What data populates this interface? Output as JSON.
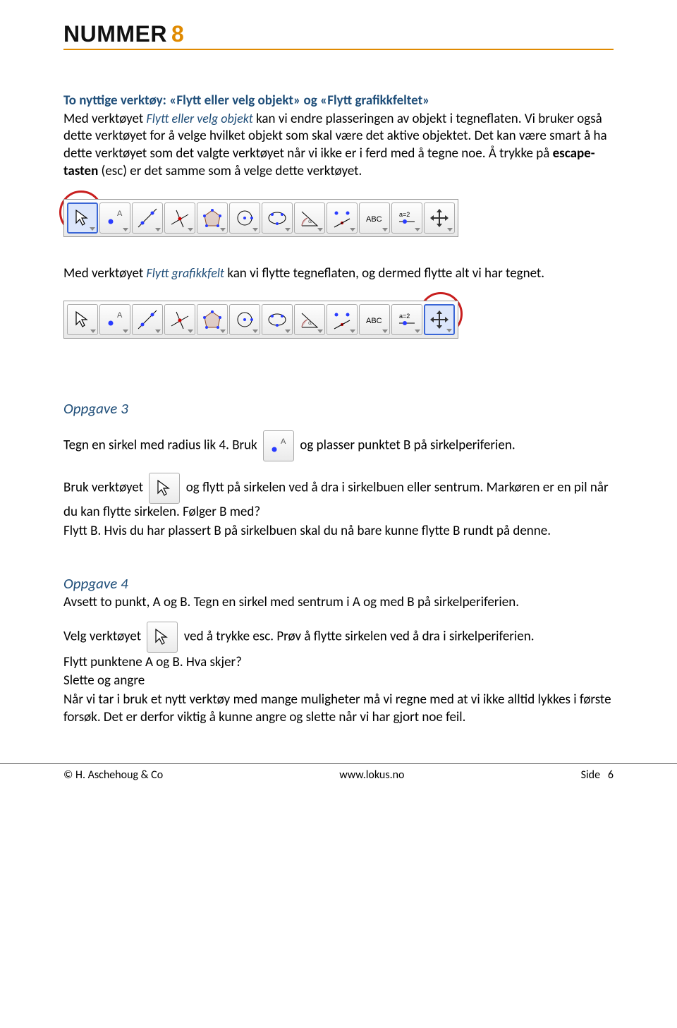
{
  "header": {
    "brand_word": "NUMMER",
    "brand_digit": "8"
  },
  "section1": {
    "title": "To nyttige verktøy: «Flytt eller velg objekt» og «Flytt grafikkfeltet»",
    "l1a": "Med verktøyet ",
    "l1_tool": "Flytt eller velg objekt",
    "l1b": " kan vi endre plasseringen av objekt i tegneflaten. Vi bruker også dette verktøyet for å velge hvilket objekt som skal være det aktive objektet. Det kan være smart å ha dette verktøyet som det valgte verktøyet når vi ikke er i ferd med å tegne noe. Å trykke på ",
    "l1_bold": "escape-tasten",
    "l1c": " (esc) er det samme som å velge dette verktøyet."
  },
  "section2": {
    "l1a": "Med verktøyet ",
    "l1_tool": "Flytt grafikkfelt",
    "l1b": " kan vi flytte tegneflaten, og dermed flytte alt vi har tegnet."
  },
  "opp3": {
    "title": "Oppgave 3",
    "p1a": "Tegn en sirkel med radius lik 4. Bruk ",
    "p1b": " og plasser punktet B på sirkelperiferien.",
    "p2a": "Bruk verktøyet ",
    "p2b": " og flytt på sirkelen ved å dra i sirkelbuen eller sentrum. Markøren er en pil når du kan flytte sirkelen. Følger B med?",
    "p3": "Flytt B. Hvis du har plassert B på sirkelbuen skal du nå bare kunne flytte B rundt på denne."
  },
  "opp4": {
    "title": "Oppgave 4",
    "p1": "Avsett to punkt, A og B. Tegn en sirkel med sentrum i A og med B på sirkelperiferien.",
    "p2a": "Velg verktøyet ",
    "p2b": " ved å trykke esc. Prøv å flytte sirkelen ved å dra i sirkelperiferien.",
    "p3": "Flytt punktene A og B. Hva skjer?",
    "p4": "Slette og angre",
    "p5": "Når vi tar i bruk et nytt verktøy med mange muligheter må vi regne med at vi ikke alltid lykkes i første forsøk. Det er derfor viktig å kunne angre og slette når vi har gjort noe feil."
  },
  "toolbar_labels": {
    "abc": "ABC",
    "a2": "a=2"
  },
  "footer": {
    "left": "© H. Aschehoug & Co",
    "center": "www.lokus.no",
    "right_label": "Side",
    "right_page": "6"
  }
}
